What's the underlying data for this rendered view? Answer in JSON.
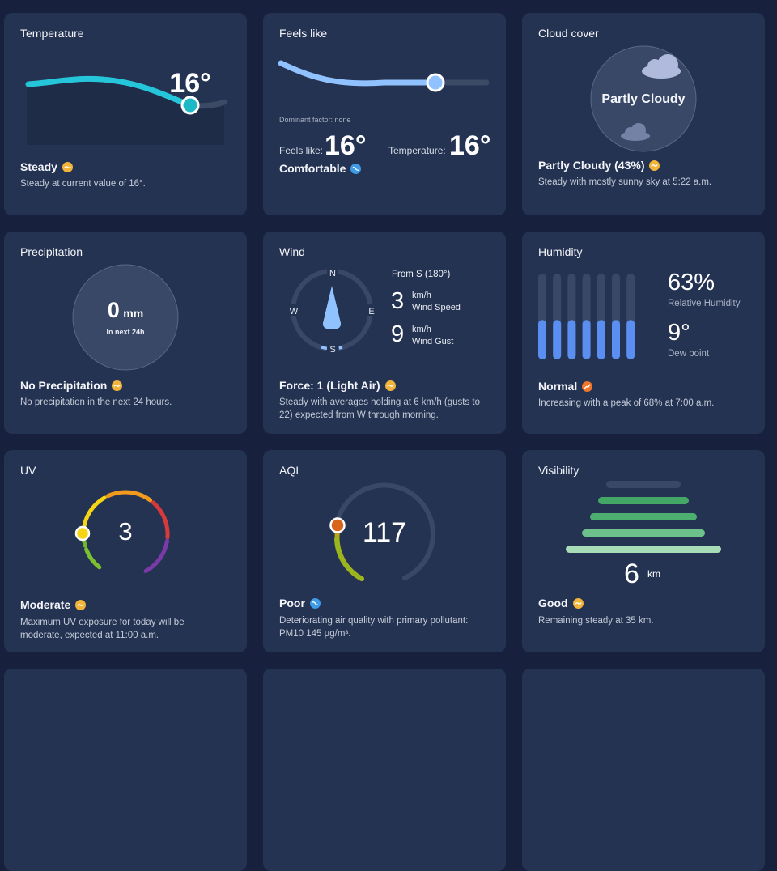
{
  "temperature": {
    "title": "Temperature",
    "value": "16°",
    "status": "Steady",
    "desc": "Steady at current value of 16°."
  },
  "feels_like": {
    "title": "Feels like",
    "dominant": "Dominant factor: none",
    "feels_label": "Feels like:",
    "feels_value": "16°",
    "temp_label": "Temperature:",
    "temp_value": "16°",
    "status": "Comfortable",
    "marker_fraction": 0.75
  },
  "cloud": {
    "title": "Cloud cover",
    "label": "Partly Cloudy",
    "status": "Partly Cloudy (43%)",
    "desc": "Steady with mostly sunny sky at 5:22 a.m."
  },
  "precipitation": {
    "title": "Precipitation",
    "value": "0",
    "unit": "mm",
    "period": "In next 24h",
    "status": "No Precipitation",
    "desc": "No precipitation in the next 24 hours."
  },
  "wind": {
    "title": "Wind",
    "compass": {
      "n": "N",
      "s": "S",
      "e": "E",
      "w": "W"
    },
    "direction": "From S (180°)",
    "speed": "3",
    "speed_unit": "km/h",
    "speed_label": "Wind Speed",
    "gust": "9",
    "gust_unit": "km/h",
    "gust_label": "Wind Gust",
    "status": "Force: 1 (Light Air)",
    "desc": "Steady with averages holding at 6 km/h (gusts to 22) expected from W through morning."
  },
  "humidity": {
    "title": "Humidity",
    "value": "63%",
    "label": "Relative Humidity",
    "dew": "9°",
    "dew_label": "Dew point",
    "status": "Normal",
    "desc": "Increasing with a peak of 68% at 7:00 a.m.",
    "bars": [
      0.46,
      0.46,
      0.46,
      0.46,
      0.46,
      0.46,
      0.46
    ]
  },
  "uv": {
    "title": "UV",
    "value": "3",
    "status": "Moderate",
    "desc": "Maximum UV exposure for today will be moderate, expected at 11:00 a.m."
  },
  "aqi": {
    "title": "AQI",
    "value": "117",
    "status": "Poor",
    "desc": "Deteriorating air quality with primary pollutant: PM10 145 μg/m³."
  },
  "visibility": {
    "title": "Visibility",
    "value": "6",
    "unit": "km",
    "status": "Good",
    "desc": "Remaining steady at 35 km."
  },
  "colors": {
    "background": "#17213d",
    "card": "#253352",
    "temp_line": "#26c6da",
    "feels_line": "#90c2ff",
    "humidity_bar": "#5a8ef0",
    "visibility_bar": "#4caf6f",
    "aqi_marker": "#d9651c",
    "uv_marker": "#f7d515"
  }
}
